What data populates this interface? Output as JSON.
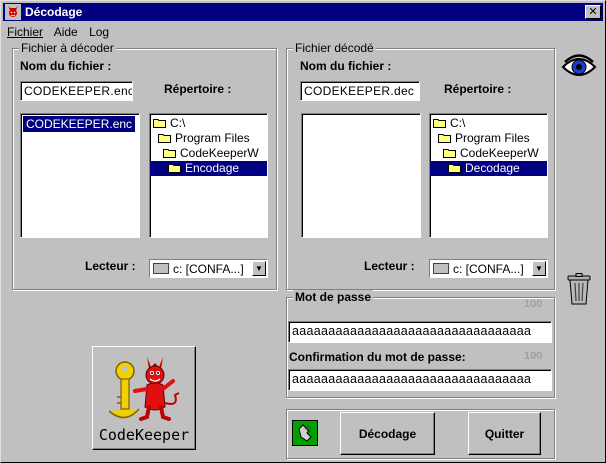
{
  "window": {
    "title": "Décodage",
    "close_label": "✕"
  },
  "menu": [
    {
      "label": "Fichier"
    },
    {
      "label": "Aide"
    },
    {
      "label": "Log"
    }
  ],
  "source": {
    "group_title": "Fichier à décoder",
    "filename_label": "Nom du fichier :",
    "filename_value": "CODEKEEPER.enc",
    "files": [
      "CODEKEEPER.enc"
    ],
    "dir_label": "Répertoire :",
    "dirs": [
      "C:\\",
      "Program Files",
      "CodeKeeperW",
      "Encodage"
    ],
    "drive_label": "Lecteur :",
    "drive_value": "c: [CONFA...]"
  },
  "dest": {
    "group_title": "Fichier décodé",
    "filename_label": "Nom du fichier :",
    "filename_value": "CODEKEEPER.dec",
    "dir_label": "Répertoire :",
    "dirs": [
      "C:\\",
      "Program Files",
      "CodeKeeperW",
      "Decodage"
    ],
    "drive_label": "Lecteur :",
    "drive_value": "c: [CONFA...]"
  },
  "password": {
    "group_title": "Mot de passe",
    "max1": "100",
    "value": "aaaaaaaaaaaaaaaaaaaaaaaaaaaaaaaaa",
    "confirm_label": "Confirmation du mot de passe:",
    "max2": "100",
    "confirm_value": "aaaaaaaaaaaaaaaaaaaaaaaaaaaaaaaaa"
  },
  "logo": {
    "text": "CodeKeeper"
  },
  "buttons": {
    "decode": "Décodage",
    "quit": "Quitter"
  },
  "icons": {
    "view": "eye-icon",
    "delete": "trash-can-icon",
    "app": "devil-key-icon",
    "action": "hand-key-icon"
  }
}
